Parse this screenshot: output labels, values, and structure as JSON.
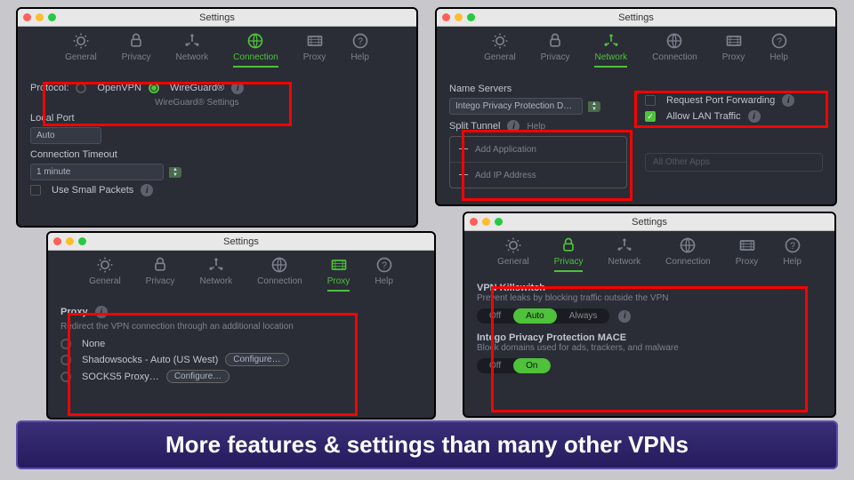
{
  "title": "Settings",
  "tabs": {
    "general": "General",
    "privacy": "Privacy",
    "network": "Network",
    "connection": "Connection",
    "proxy": "Proxy",
    "help": "Help"
  },
  "connection": {
    "protocol_label": "Protocol:",
    "openvpn": "OpenVPN",
    "wireguard": "WireGuard®",
    "wg_settings": "WireGuard® Settings",
    "local_port_label": "Local Port",
    "local_port_value": "Auto",
    "timeout_label": "Connection Timeout",
    "timeout_value": "1 minute",
    "small_packets": "Use Small Packets"
  },
  "network": {
    "name_servers_label": "Name Servers",
    "name_servers_value": "Intego Privacy Protection D…",
    "port_forward": "Request Port Forwarding",
    "allow_lan": "Allow LAN Traffic",
    "split_tunnel_label": "Split Tunnel",
    "help_link": "Help",
    "add_app": "Add Application",
    "add_ip": "Add IP Address",
    "all_other": "All Other Apps"
  },
  "proxy": {
    "header": "Proxy",
    "desc": "Redirect the VPN connection through an additional location",
    "none": "None",
    "shadowsocks": "Shadowsocks - Auto (US West)",
    "socks5": "SOCKS5 Proxy…",
    "configure": "Configure…"
  },
  "privacy": {
    "kill_label": "VPN Killswitch",
    "kill_desc": "Prevent leaks by blocking traffic outside the VPN",
    "off": "Off",
    "auto": "Auto",
    "always": "Always",
    "mace_label": "Intego Privacy Protection MACE",
    "mace_desc": "Block domains used for ads, trackers, and malware",
    "on": "On"
  },
  "banner": "More features & settings than many other VPNs"
}
